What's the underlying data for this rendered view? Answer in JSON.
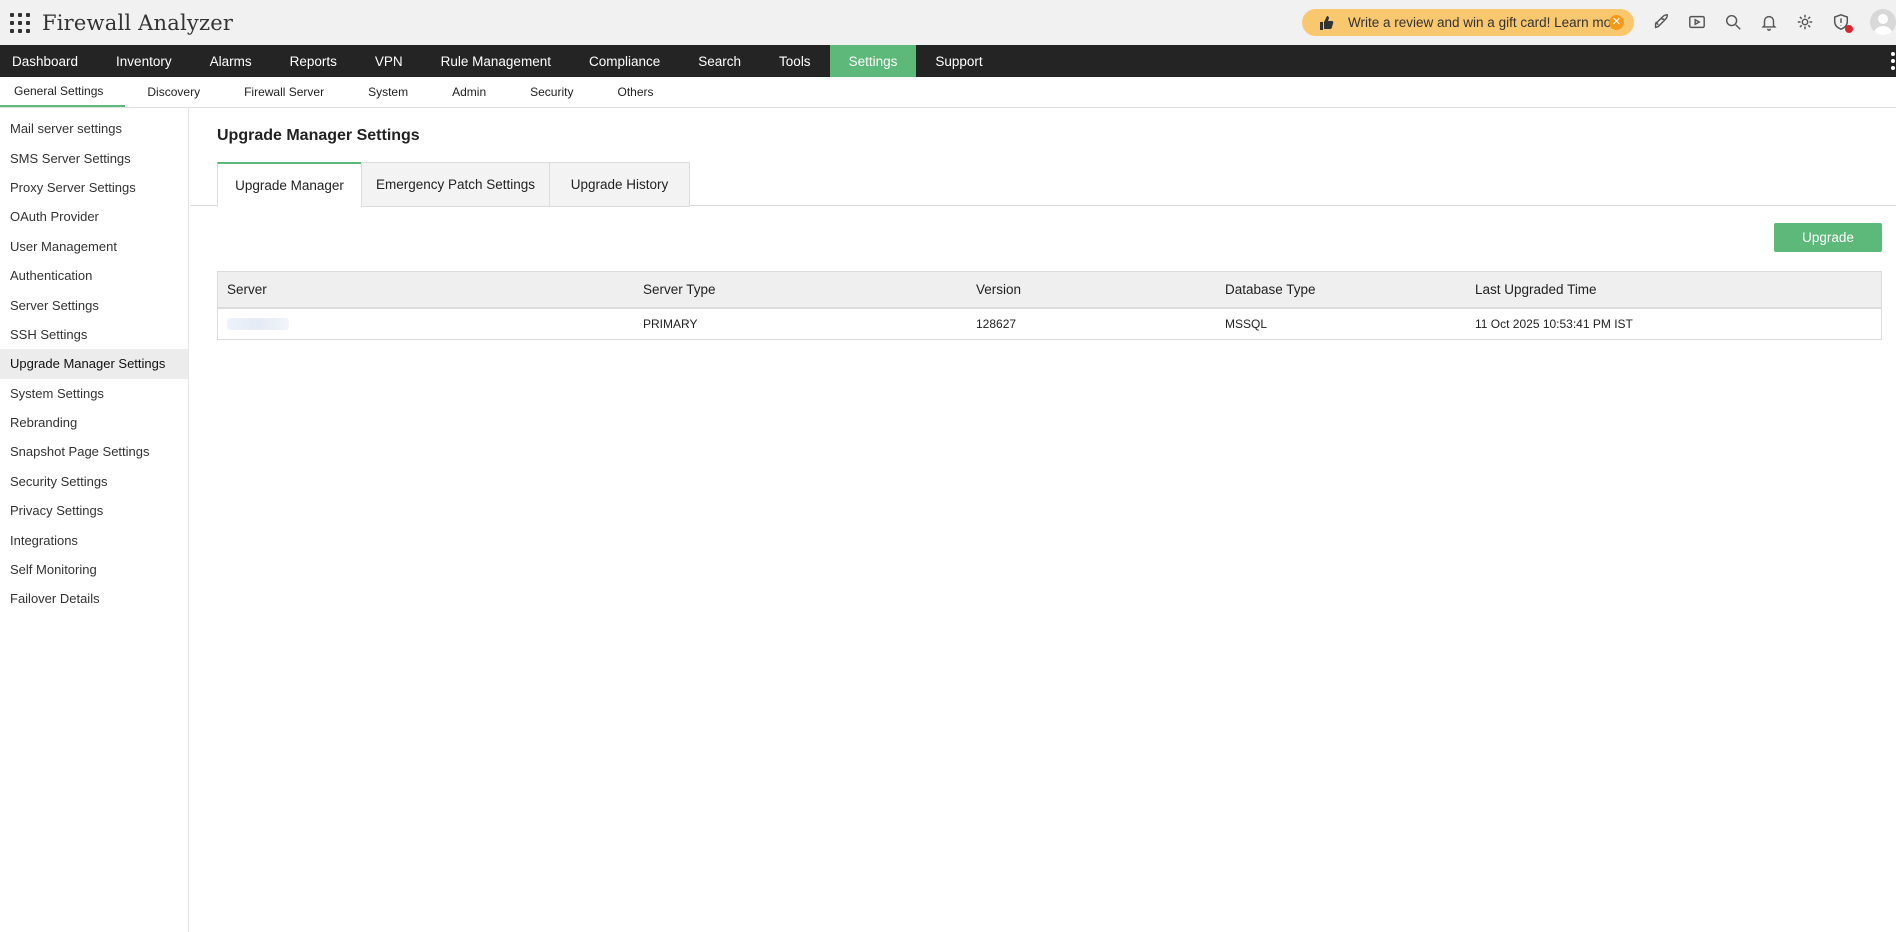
{
  "app": {
    "title": "Firewall Analyzer"
  },
  "promo": {
    "text": "Write a review and win a gift card! Learn more"
  },
  "header_icons": [
    "rocket-icon",
    "video-icon",
    "search-icon",
    "bell-icon",
    "gear-icon",
    "shield-alert-icon",
    "user-avatar"
  ],
  "main_nav": {
    "items": [
      {
        "label": "Dashboard"
      },
      {
        "label": "Inventory"
      },
      {
        "label": "Alarms"
      },
      {
        "label": "Reports"
      },
      {
        "label": "VPN"
      },
      {
        "label": "Rule Management"
      },
      {
        "label": "Compliance"
      },
      {
        "label": "Search"
      },
      {
        "label": "Tools"
      },
      {
        "label": "Settings"
      },
      {
        "label": "Support"
      }
    ],
    "active": "Settings"
  },
  "sub_nav": {
    "items": [
      {
        "label": "General Settings"
      },
      {
        "label": "Discovery"
      },
      {
        "label": "Firewall Server"
      },
      {
        "label": "System"
      },
      {
        "label": "Admin"
      },
      {
        "label": "Security"
      },
      {
        "label": "Others"
      }
    ],
    "active": "General Settings"
  },
  "sidebar": {
    "items": [
      {
        "label": "Mail server settings"
      },
      {
        "label": "SMS Server Settings"
      },
      {
        "label": "Proxy Server Settings"
      },
      {
        "label": "OAuth Provider"
      },
      {
        "label": "User Management"
      },
      {
        "label": "Authentication"
      },
      {
        "label": "Server Settings"
      },
      {
        "label": "SSH Settings"
      },
      {
        "label": "Upgrade Manager Settings"
      },
      {
        "label": "System Settings"
      },
      {
        "label": "Rebranding"
      },
      {
        "label": "Snapshot Page Settings"
      },
      {
        "label": "Security Settings"
      },
      {
        "label": "Privacy Settings"
      },
      {
        "label": "Integrations"
      },
      {
        "label": "Self Monitoring"
      },
      {
        "label": "Failover Details"
      }
    ],
    "active": "Upgrade Manager Settings"
  },
  "page": {
    "title": "Upgrade Manager Settings",
    "tabs": [
      {
        "label": "Upgrade Manager"
      },
      {
        "label": "Emergency Patch Settings"
      },
      {
        "label": "Upgrade History"
      }
    ],
    "active_tab": "Upgrade Manager",
    "upgrade_button": "Upgrade"
  },
  "table": {
    "columns": [
      "Server",
      "Server Type",
      "Version",
      "Database Type",
      "Last Upgraded Time"
    ],
    "rows": [
      {
        "server": "",
        "server_type": "PRIMARY",
        "version": "128627",
        "database_type": "MSSQL",
        "last_upgraded": "11 Oct 2025 10:53:41 PM IST"
      }
    ]
  },
  "colors": {
    "accent": "#5cb97a",
    "nav_bg": "#242424",
    "promo_bg": "#f9c86e"
  }
}
